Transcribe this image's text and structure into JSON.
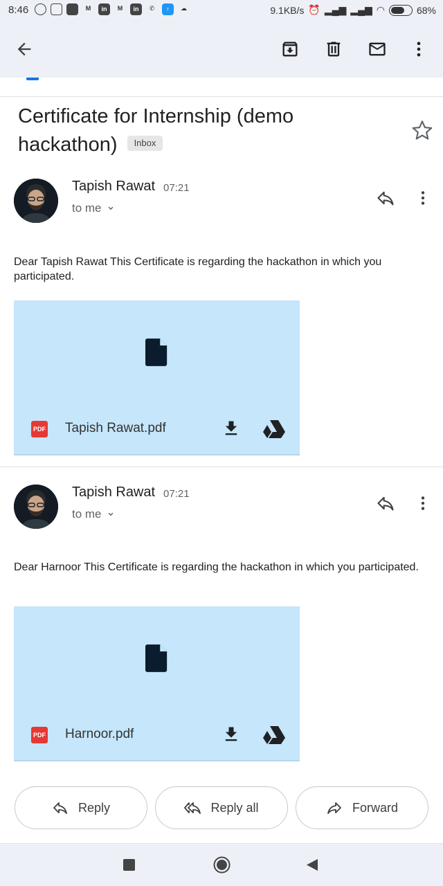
{
  "status_bar": {
    "time": "8:46",
    "notification_icons": [
      "whatsapp-icon",
      "instagram-icon",
      "youtube-icon",
      "gmail-icon",
      "linkedin-icon",
      "gmail-icon",
      "linkedin-icon",
      "call-icon",
      "upload-icon",
      "cloud-icon"
    ],
    "network_speed": "9.1KB/s",
    "battery_percent": "68%",
    "battery_level": 0.68
  },
  "toolbar": {
    "back": "back-arrow-icon",
    "archive": "archive-icon",
    "delete": "delete-icon",
    "mark_unread": "mail-icon",
    "more": "more-vert-icon"
  },
  "subject": {
    "title": "Certificate for Internship (demo hackathon)",
    "label": "Inbox"
  },
  "messages": [
    {
      "sender": "Tapish Rawat",
      "time": "07:21",
      "recipient": "to me",
      "body": "Dear Tapish Rawat This Certificate is regarding the hackathon in which you participated.",
      "attachment": {
        "name": "Tapish Rawat.pdf",
        "type": "PDF"
      }
    },
    {
      "sender": "Tapish Rawat",
      "time": "07:21",
      "recipient": "to me",
      "body": "Dear Harnoor This Certificate is regarding the hackathon in which you participated.",
      "attachment": {
        "name": "Harnoor.pdf",
        "type": "PDF"
      }
    }
  ],
  "actions": {
    "reply": "Reply",
    "reply_all": "Reply all",
    "forward": "Forward"
  },
  "colors": {
    "appbar_bg": "#eef0f7",
    "attachment_bg": "#c5e6fb",
    "pdf_red": "#e53935",
    "accent_blue": "#1a73e8"
  }
}
